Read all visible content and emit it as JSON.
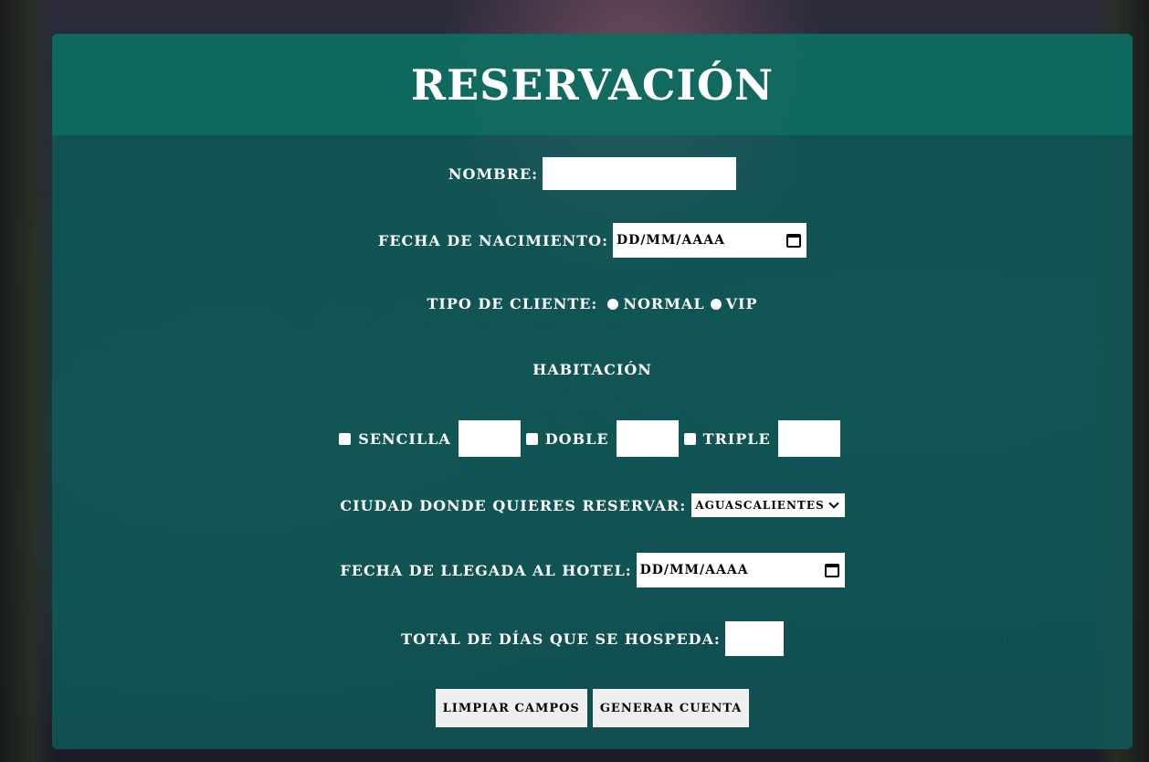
{
  "form": {
    "title": "RESERVACIÓN",
    "nombre_label": "NOMBRE:",
    "nombre_value": "",
    "fecha_nacimiento_label": "FECHA DE NACIMIENTO:",
    "fecha_nacimiento_placeholder": "DD/MM/AAAA",
    "tipo_cliente_label": "TIPO DE CLIENTE:",
    "tipo_cliente_options": [
      "NORMAL",
      "VIP"
    ],
    "habitacion_heading": "HABITACIÓN",
    "habitacion_options": [
      "SENCILLA",
      "DOBLE",
      "TRIPLE"
    ],
    "ciudad_label": "CIUDAD DONDE QUIERES RESERVAR:",
    "ciudad_selected": "AGUASCALIENTES",
    "fecha_llegada_label": "FECHA DE LLEGADA AL HOTEL:",
    "fecha_llegada_placeholder": "DD/MM/AAAA",
    "total_dias_label": "TOTAL DE DÍAS QUE SE HOSPEDA:",
    "buttons": {
      "clear": "LIMPIAR CAMPOS",
      "generate": "GENERAR CUENTA"
    }
  },
  "colors": {
    "panel": "#0e5e5c",
    "header": "#106e62",
    "text": "#ffffff"
  },
  "icons": {
    "calendar": "calendar-icon",
    "dropdown": "chevron-down-icon"
  }
}
